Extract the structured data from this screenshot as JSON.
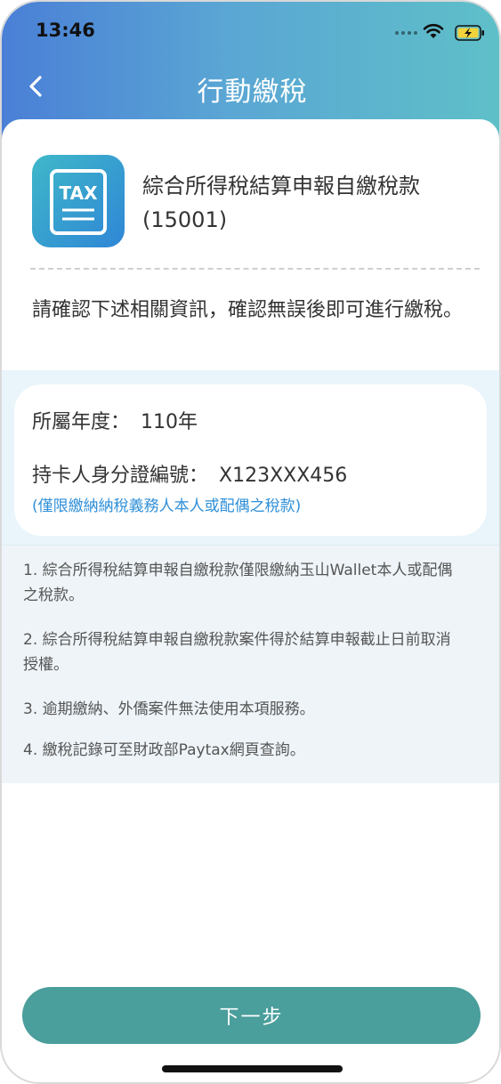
{
  "status_bar": {
    "time": "13:46"
  },
  "nav": {
    "title": "行動繳稅"
  },
  "service": {
    "icon_text": "TAX",
    "name_line1": "綜合所得稅結算申報自繳稅款",
    "name_line2": "(15001)"
  },
  "confirm_text": "請確認下述相關資訊，確認無誤後即可進行繳稅。",
  "info": {
    "year_label": "所屬年度：",
    "year_value": "110年",
    "id_label": "持卡人身分證編號：",
    "id_value": "X123XXX456",
    "note": "(僅限繳納納稅義務人本人或配偶之稅款)"
  },
  "notes": [
    "1. 綜合所得稅結算申報自繳稅款僅限繳納玉山Wallet本人或配偶之稅款。",
    "2. 綜合所得稅結算申報自繳稅款案件得於結算申報截止日前取消授權。",
    "3. 逾期繳納、外僑案件無法使用本項服務。",
    "4. 繳稅記錄可至財政部Paytax網頁查詢。"
  ],
  "button": {
    "next_label": "下一步"
  },
  "colors": {
    "accent": "#4a9e9b",
    "link": "#2f8fd8",
    "band": "#e9f5fa"
  },
  "icons": {
    "back": "chevron-left-icon",
    "wifi": "wifi-icon",
    "battery": "battery-charging-icon",
    "tax": "tax-document-icon"
  }
}
